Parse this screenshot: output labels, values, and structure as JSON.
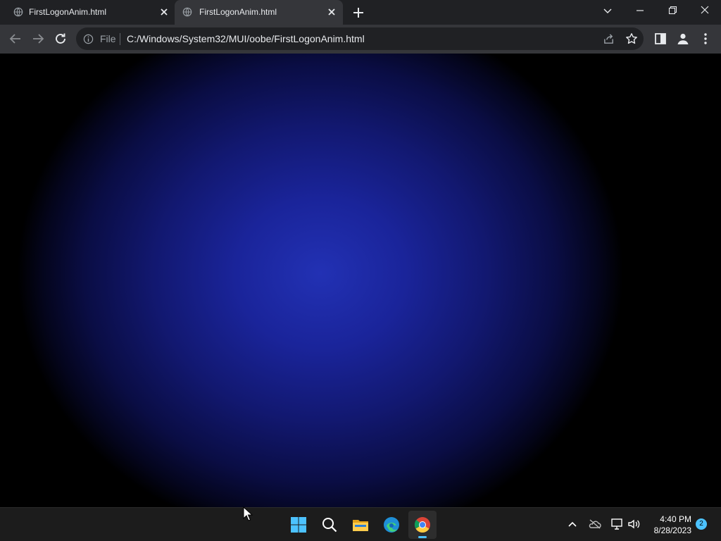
{
  "browser": {
    "tabs": [
      {
        "title": "FirstLogonAnim.html",
        "active": false
      },
      {
        "title": "FirstLogonAnim.html",
        "active": true
      }
    ],
    "omnibox": {
      "scheme_label": "File",
      "url": "C:/Windows/System32/MUI/oobe/FirstLogonAnim.html"
    }
  },
  "content": {
    "background_colors": [
      "#2231b4",
      "#121870",
      "#000000"
    ]
  },
  "taskbar": {
    "apps": [
      {
        "name": "start",
        "icon": "windows-start-icon"
      },
      {
        "name": "search",
        "icon": "search-icon"
      },
      {
        "name": "file-explorer",
        "icon": "folder-icon"
      },
      {
        "name": "edge",
        "icon": "edge-icon"
      },
      {
        "name": "chrome",
        "icon": "chrome-icon",
        "active": true
      }
    ],
    "clock": {
      "time": "4:40 PM",
      "date": "8/28/2023"
    },
    "notification_count": "2"
  },
  "colors": {
    "accent": "#4cc2ff",
    "tabstrip": "#202124",
    "toolbar": "#35363a",
    "taskbar": "#1c1c1c"
  }
}
